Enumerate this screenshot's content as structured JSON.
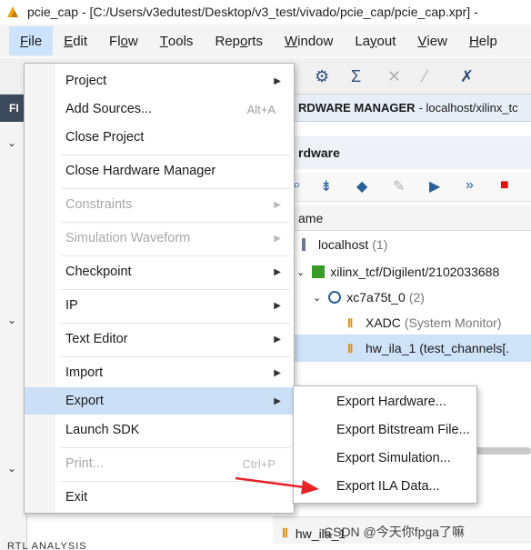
{
  "window": {
    "title": "pcie_cap - [C:/Users/v3edutest/Desktop/v3_test/vivado/pcie_cap/pcie_cap.xpr] - ",
    "logo_icon": "vivado-logo-icon"
  },
  "menubar": {
    "items": [
      {
        "label": "File",
        "u": "F",
        "rest": "ile"
      },
      {
        "label": "Edit",
        "u": "E",
        "rest": "dit"
      },
      {
        "label": "Flow",
        "pre": "Fl",
        "u": "o",
        "rest": "w"
      },
      {
        "label": "Tools",
        "u": "T",
        "rest": "ools"
      },
      {
        "label": "Reports",
        "pre": "Rep",
        "u": "o",
        "rest": "rts"
      },
      {
        "label": "Window",
        "u": "W",
        "rest": "indow"
      },
      {
        "label": "Layout",
        "pre": "La",
        "u": "y",
        "rest": "out"
      },
      {
        "label": "View",
        "u": "V",
        "rest": "iew"
      },
      {
        "label": "Help",
        "u": "H",
        "rest": "elp"
      }
    ]
  },
  "file_menu": {
    "items": [
      {
        "label": "Project",
        "submenu": true
      },
      {
        "label": "Add Sources...",
        "shortcut": "Alt+A"
      },
      {
        "label": "Close Project"
      },
      {
        "label": "Close Hardware Manager"
      },
      {
        "label": "Constraints",
        "submenu": true,
        "disabled": true
      },
      {
        "label": "Simulation Waveform",
        "submenu": true,
        "disabled": true
      },
      {
        "label": "Checkpoint",
        "submenu": true
      },
      {
        "label": "IP",
        "submenu": true
      },
      {
        "label": "Text Editor",
        "submenu": true
      },
      {
        "label": "Import",
        "submenu": true
      },
      {
        "label": "Export",
        "submenu": true,
        "highlighted": true
      },
      {
        "label": "Launch SDK"
      },
      {
        "label": "Print...",
        "shortcut": "Ctrl+P",
        "disabled": true
      },
      {
        "label": "Exit"
      }
    ]
  },
  "export_submenu": {
    "items": [
      {
        "label": "Export Hardware..."
      },
      {
        "label": "Export Bitstream File..."
      },
      {
        "label": "Export Simulation..."
      },
      {
        "label": "Export ILA Data..."
      }
    ]
  },
  "hardware_manager": {
    "header_bold": "RDWARE MANAGER",
    "header_rest": "- localhost/xilinx_tc",
    "panel_title": "rdware",
    "column_name": "ame",
    "tree": [
      {
        "label": "localhost",
        "count": "(1)"
      },
      {
        "label": "xilinx_tcf/Digilent/2102033688",
        "count": ""
      },
      {
        "label": "xc7a75t_0",
        "count": "(2)"
      },
      {
        "label": "XADC",
        "count": "(System Monitor)"
      },
      {
        "label": "hw_ila_1",
        "count": "(test_channels[."
      }
    ],
    "bottom_tab": "hw_ila_1"
  },
  "watermark": "CSDN @今天你fpga了嘛",
  "left_panel": {
    "label": "FI",
    "bottom_text": "RTL ANALYSIS"
  },
  "colors": {
    "menu_highlight": "#cbe0f7",
    "selected_row": "#cfe3f8",
    "annotation_arrow": "#e8232a"
  }
}
